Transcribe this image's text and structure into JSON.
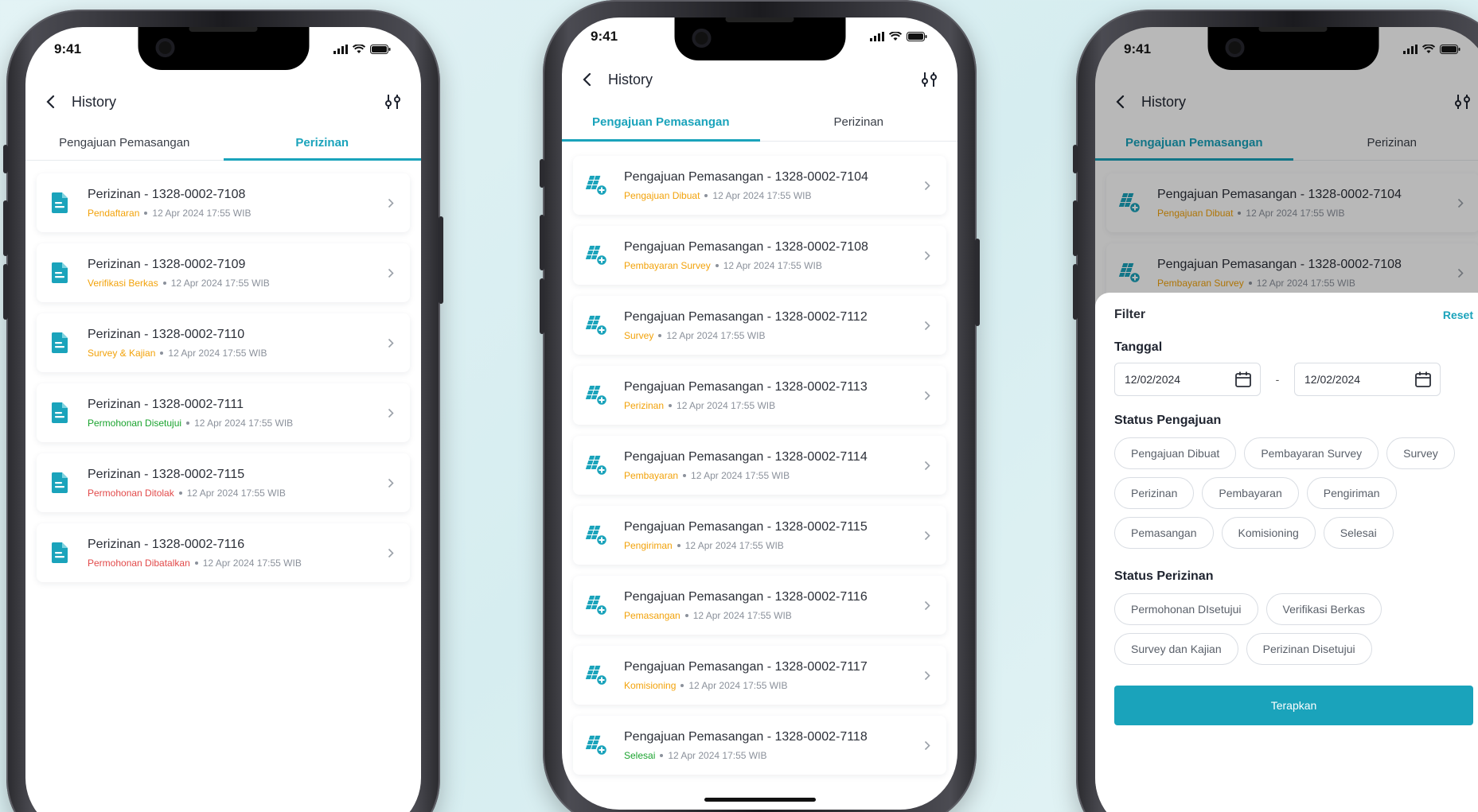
{
  "colors": {
    "accent": "#1aa3bb",
    "status_orange": "#f2a20a",
    "status_green": "#1aa32e",
    "status_red": "#e24a4a"
  },
  "status_bar": {
    "time": "9:41"
  },
  "phone1": {
    "header": {
      "title": "History"
    },
    "tabs": [
      {
        "label": "Pengajuan Pemasangan"
      },
      {
        "label": "Perizinan"
      }
    ],
    "active_tab": "Perizinan",
    "items": [
      {
        "title": "Perizinan - 1328-0002-7108",
        "status": "Pendaftaran",
        "status_color": "orange",
        "datetime": "12 Apr 2024 17:55 WIB",
        "icon": "document-icon"
      },
      {
        "title": "Perizinan - 1328-0002-7109",
        "status": "Verifikasi Berkas",
        "status_color": "orange",
        "datetime": "12 Apr 2024 17:55 WIB",
        "icon": "document-icon"
      },
      {
        "title": "Perizinan - 1328-0002-7110",
        "status": "Survey & Kajian",
        "status_color": "orange",
        "datetime": "12 Apr 2024 17:55 WIB",
        "icon": "document-icon"
      },
      {
        "title": "Perizinan - 1328-0002-7111",
        "status": "Permohonan Disetujui",
        "status_color": "green",
        "datetime": "12 Apr 2024 17:55 WIB",
        "icon": "document-icon"
      },
      {
        "title": "Perizinan - 1328-0002-7115",
        "status": "Permohonan Ditolak",
        "status_color": "red",
        "datetime": "12 Apr 2024 17:55 WIB",
        "icon": "document-icon"
      },
      {
        "title": "Perizinan - 1328-0002-7116",
        "status": "Permohonan Dibatalkan",
        "status_color": "red",
        "datetime": "12 Apr 2024 17:55 WIB",
        "icon": "document-icon"
      }
    ]
  },
  "phone2": {
    "header": {
      "title": "History"
    },
    "tabs": [
      {
        "label": "Pengajuan Pemasangan"
      },
      {
        "label": "Perizinan"
      }
    ],
    "active_tab": "Pengajuan Pemasangan",
    "items": [
      {
        "title": "Pengajuan Pemasangan - 1328-0002-7104",
        "status": "Pengajuan Dibuat",
        "status_color": "orange",
        "datetime": "12 Apr 2024 17:55 WIB",
        "icon": "solar-panel-add-icon"
      },
      {
        "title": "Pengajuan Pemasangan - 1328-0002-7108",
        "status": "Pembayaran Survey",
        "status_color": "orange",
        "datetime": "12 Apr 2024 17:55 WIB",
        "icon": "solar-panel-add-icon"
      },
      {
        "title": "Pengajuan Pemasangan - 1328-0002-7112",
        "status": "Survey",
        "status_color": "orange",
        "datetime": "12 Apr 2024 17:55 WIB",
        "icon": "solar-panel-add-icon"
      },
      {
        "title": "Pengajuan Pemasangan - 1328-0002-7113",
        "status": "Perizinan",
        "status_color": "orange",
        "datetime": "12 Apr 2024 17:55 WIB",
        "icon": "solar-panel-add-icon"
      },
      {
        "title": "Pengajuan Pemasangan - 1328-0002-7114",
        "status": "Pembayaran",
        "status_color": "orange",
        "datetime": "12 Apr 2024 17:55 WIB",
        "icon": "solar-panel-add-icon"
      },
      {
        "title": "Pengajuan Pemasangan - 1328-0002-7115",
        "status": "Pengiriman",
        "status_color": "orange",
        "datetime": "12 Apr 2024 17:55 WIB",
        "icon": "solar-panel-add-icon"
      },
      {
        "title": "Pengajuan Pemasangan - 1328-0002-7116",
        "status": "Pemasangan",
        "status_color": "orange",
        "datetime": "12 Apr 2024 17:55 WIB",
        "icon": "solar-panel-add-icon"
      },
      {
        "title": "Pengajuan Pemasangan - 1328-0002-7117",
        "status": "Komisioning",
        "status_color": "orange",
        "datetime": "12 Apr 2024 17:55 WIB",
        "icon": "solar-panel-add-icon"
      },
      {
        "title": "Pengajuan Pemasangan - 1328-0002-7118",
        "status": "Selesai",
        "status_color": "green",
        "datetime": "12 Apr 2024 17:55 WIB",
        "icon": "solar-panel-add-icon"
      }
    ]
  },
  "phone3": {
    "header": {
      "title": "History"
    },
    "tabs": [
      {
        "label": "Pengajuan Pemasangan"
      },
      {
        "label": "Perizinan"
      }
    ],
    "active_tab": "Pengajuan Pemasangan",
    "items": [
      {
        "title": "Pengajuan Pemasangan - 1328-0002-7104",
        "status": "Pengajuan Dibuat",
        "status_color": "orange",
        "datetime": "12 Apr 2024 17:55 WIB",
        "icon": "solar-panel-add-icon"
      },
      {
        "title": "Pengajuan Pemasangan - 1328-0002-7108",
        "status": "Pembayaran Survey",
        "status_color": "orange",
        "datetime": "12 Apr 2024 17:55 WIB",
        "icon": "solar-panel-add-icon"
      }
    ],
    "filter": {
      "title": "Filter",
      "reset_label": "Reset",
      "date_section": "Tanggal",
      "date_from": "12/02/2024",
      "date_separator": "-",
      "date_to": "12/02/2024",
      "status_pengajuan_label": "Status Pengajuan",
      "status_pengajuan": [
        "Pengajuan Dibuat",
        "Pembayaran Survey",
        "Survey",
        "Perizinan",
        "Pembayaran",
        "Pengiriman",
        "Pemasangan",
        "Komisioning",
        "Selesai"
      ],
      "status_perizinan_label": "Status Perizinan",
      "status_perizinan": [
        "Permohonan DIsetujui",
        "Verifikasi Berkas",
        "Survey dan Kajian",
        "Perizinan Disetujui"
      ],
      "apply_label": "Terapkan"
    }
  }
}
